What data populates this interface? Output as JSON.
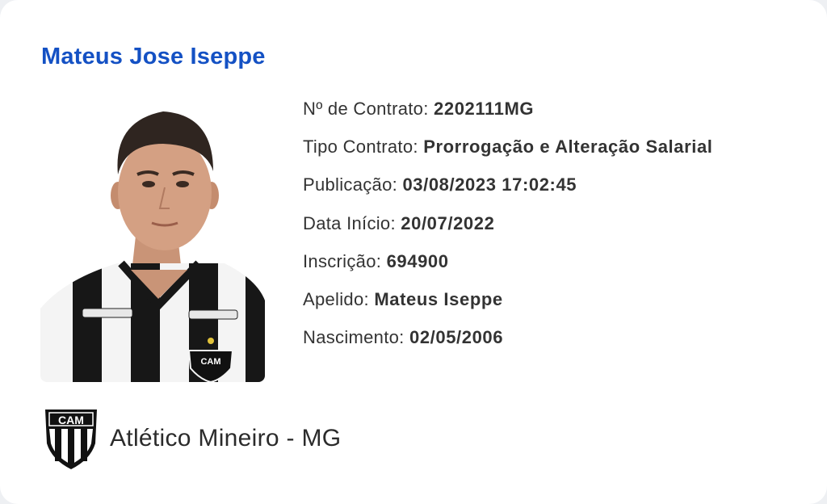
{
  "player": {
    "name": "Mateus Jose Iseppe",
    "photo_description": "player-photo"
  },
  "details": [
    {
      "label": "Nº de Contrato: ",
      "value": "2202111MG"
    },
    {
      "label": "Tipo Contrato: ",
      "value": "Prorrogação e Alteração Salarial"
    },
    {
      "label": "Publicação: ",
      "value": "03/08/2023 17:02:45"
    },
    {
      "label": "Data Início: ",
      "value": "20/07/2022"
    },
    {
      "label": "Inscrição: ",
      "value": "694900"
    },
    {
      "label": "Apelido: ",
      "value": "Mateus Iseppe"
    },
    {
      "label": "Nascimento: ",
      "value": "02/05/2006"
    }
  ],
  "club": {
    "name": "Atlético Mineiro - MG",
    "logo_text": "CAM",
    "logo_icon": "club-crest-icon"
  },
  "colors": {
    "name_accent": "#1451c4",
    "text": "#333333"
  }
}
